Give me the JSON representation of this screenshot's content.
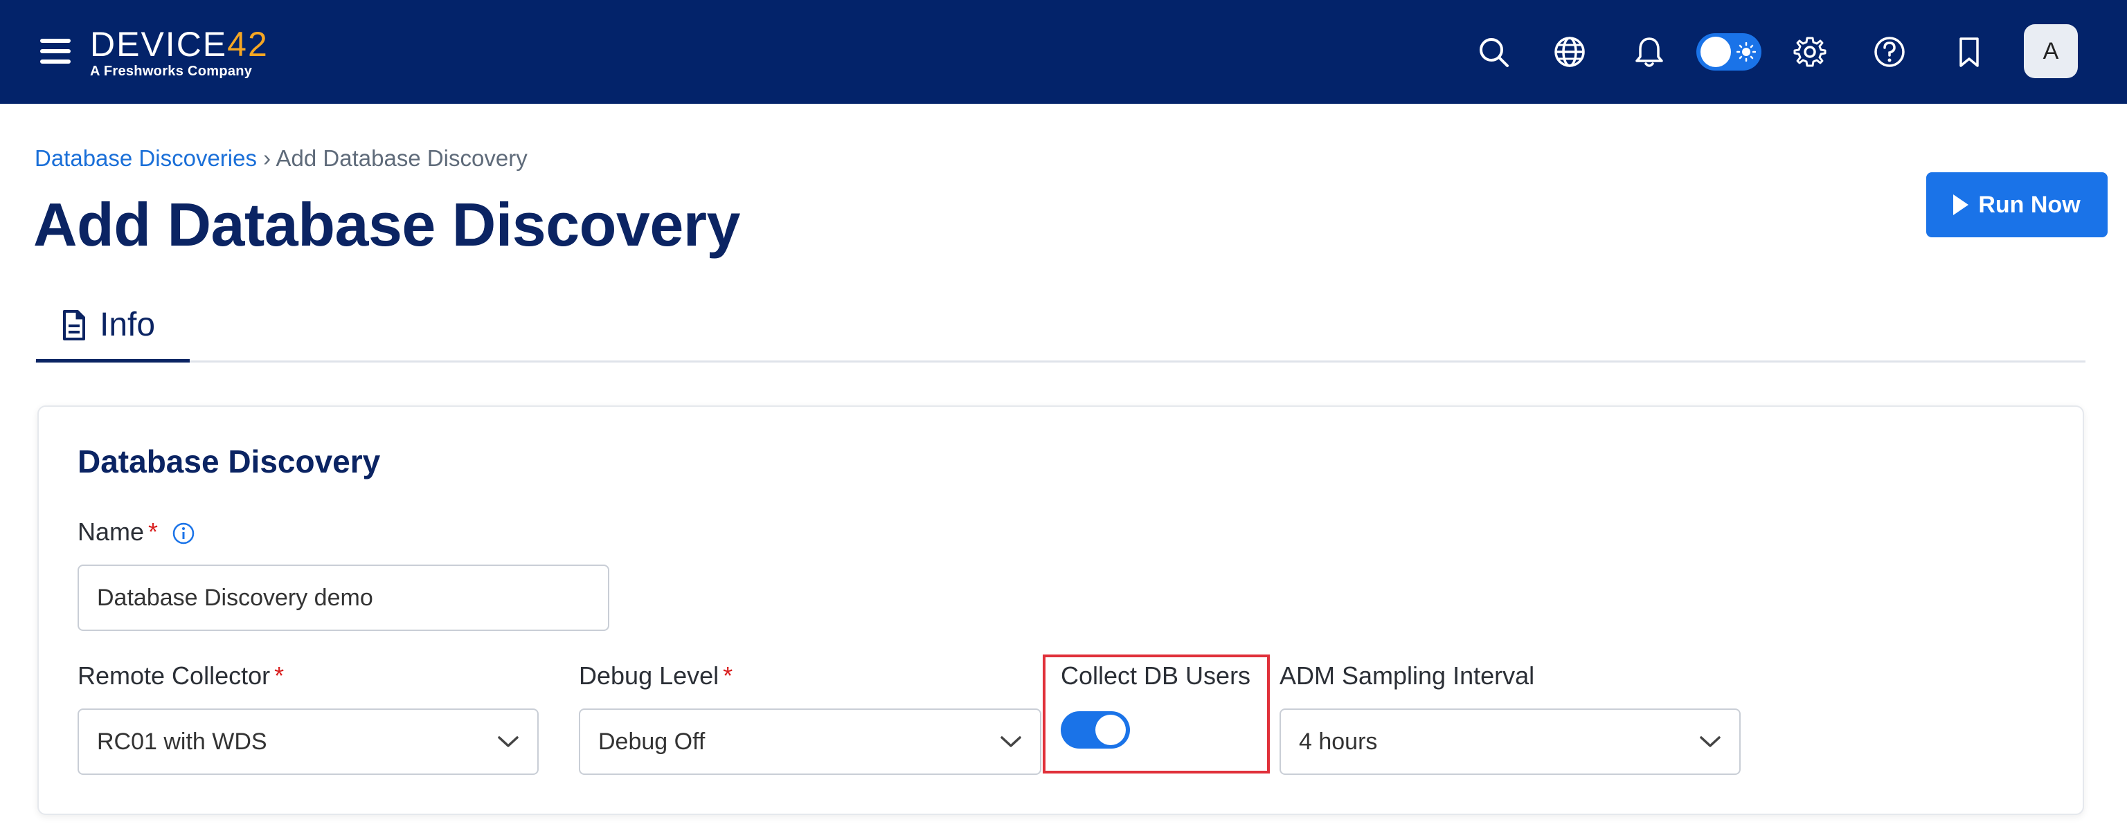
{
  "header": {
    "logo_text": "DEVICE",
    "logo_number": "42",
    "logo_tagline": "A Freshworks Company",
    "icons": [
      "menu-icon",
      "search-icon",
      "globe-icon",
      "bell-icon",
      "theme-toggle",
      "gear-icon",
      "help-icon",
      "bookmark-icon"
    ],
    "avatar_initial": "A"
  },
  "breadcrumb": {
    "parent": "Database Discoveries",
    "separator": "›",
    "current": "Add Database Discovery"
  },
  "page": {
    "title": "Add Database Discovery",
    "run_now_label": "Run Now"
  },
  "tabs": [
    {
      "label": "Info",
      "icon": "document-icon",
      "active": true
    }
  ],
  "form": {
    "section_title": "Database Discovery",
    "name": {
      "label": "Name",
      "required_mark": "*",
      "value": "Database Discovery demo"
    },
    "remote_collector": {
      "label": "Remote Collector",
      "required_mark": "*",
      "value": "RC01 with WDS"
    },
    "debug_level": {
      "label": "Debug Level",
      "required_mark": "*",
      "value": "Debug Off"
    },
    "collect_db_users": {
      "label": "Collect DB Users",
      "checked": true
    },
    "adm_sampling_interval": {
      "label": "ADM Sampling Interval",
      "value": "4 hours"
    }
  },
  "colors": {
    "topbar": "#03236a",
    "accent": "#1a73e8",
    "title": "#0b2463",
    "required": "#d92020",
    "highlight": "#e0303a",
    "logo_number": "#f5a623"
  }
}
